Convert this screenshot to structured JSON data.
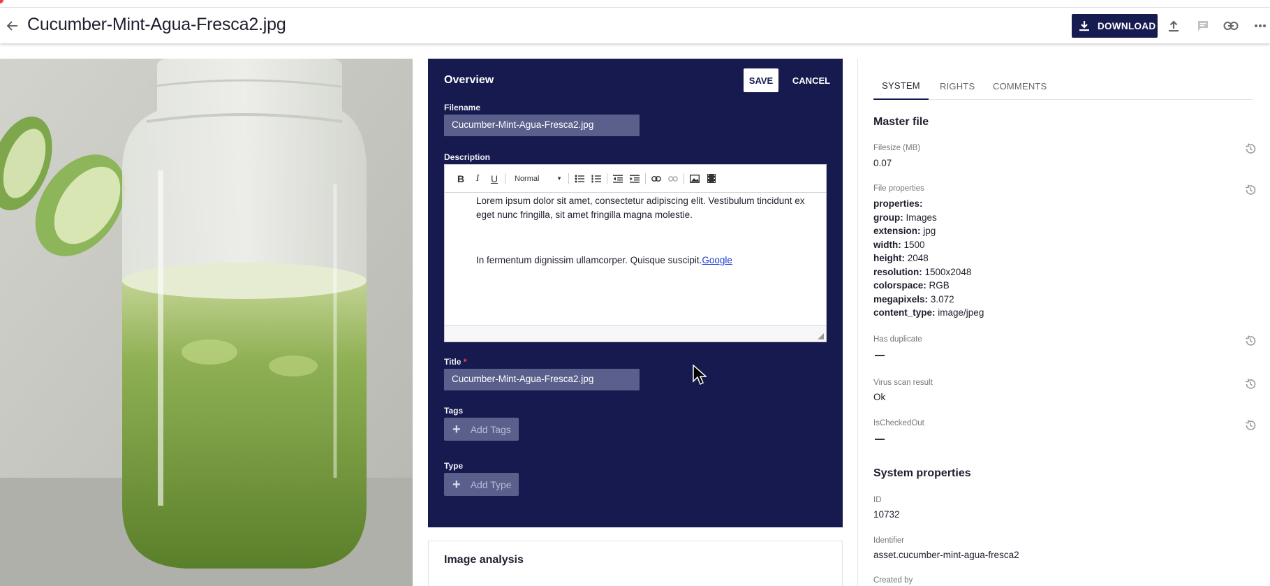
{
  "header": {
    "title": "Cucumber-Mint-Agua-Fresca2.jpg",
    "download_label": "DOWNLOAD",
    "icons": [
      "arrow-back-icon",
      "download-icon",
      "upload-icon",
      "comment-icon",
      "link-icon",
      "more-icon"
    ]
  },
  "overview": {
    "title": "Overview",
    "save_label": "SAVE",
    "cancel_label": "CANCEL",
    "filename_label": "Filename",
    "filename_value": "Cucumber-Mint-Agua-Fresca2.jpg",
    "description_label": "Description",
    "editor": {
      "format_select": "Normal",
      "paragraph1": "Lorem ipsum dolor sit amet, consectetur adipiscing elit. Vestibulum tincidunt ex eget nunc fringilla, sit amet fringilla magna molestie.",
      "paragraph2": "In fermentum dignissim ullamcorper. Quisque suscipit.",
      "link_text": "Google"
    },
    "title_label": "Title",
    "title_required_mark": "*",
    "title_value": "Cucumber-Mint-Agua-Fresca2.jpg",
    "tags_label": "Tags",
    "tags_add": "Add Tags",
    "type_label": "Type",
    "type_add": "Add Type"
  },
  "analysis": {
    "title": "Image analysis"
  },
  "sidebar": {
    "tabs": [
      {
        "label": "SYSTEM",
        "active": true
      },
      {
        "label": "RIGHTS",
        "active": false
      },
      {
        "label": "COMMENTS",
        "active": false
      }
    ],
    "master_file_title": "Master file",
    "filesize_label": "Filesize (MB)",
    "filesize_value": "0.07",
    "file_props_label": "File properties",
    "file_props": [
      {
        "key": "properties:",
        "value": ""
      },
      {
        "key": "group:",
        "value": "Images"
      },
      {
        "key": "extension:",
        "value": "jpg"
      },
      {
        "key": "width:",
        "value": "1500"
      },
      {
        "key": "height:",
        "value": "2048"
      },
      {
        "key": "resolution:",
        "value": "1500x2048"
      },
      {
        "key": "colorspace:",
        "value": "RGB"
      },
      {
        "key": "megapixels:",
        "value": "3.072"
      },
      {
        "key": "content_type:",
        "value": "image/jpeg"
      }
    ],
    "has_duplicate_label": "Has duplicate",
    "virus_scan_label": "Virus scan result",
    "virus_scan_value": "Ok",
    "checked_out_label": "IsCheckedOut",
    "system_props_title": "System properties",
    "id_label": "ID",
    "id_value": "10732",
    "identifier_label": "Identifier",
    "identifier_value": "asset.cucumber-mint-agua-fresca2",
    "created_by_label": "Created by"
  },
  "colors": {
    "navy": "#161a4f",
    "field_bg": "#5a5f8c",
    "link": "#1a3ad6",
    "required": "#ff4b55"
  }
}
